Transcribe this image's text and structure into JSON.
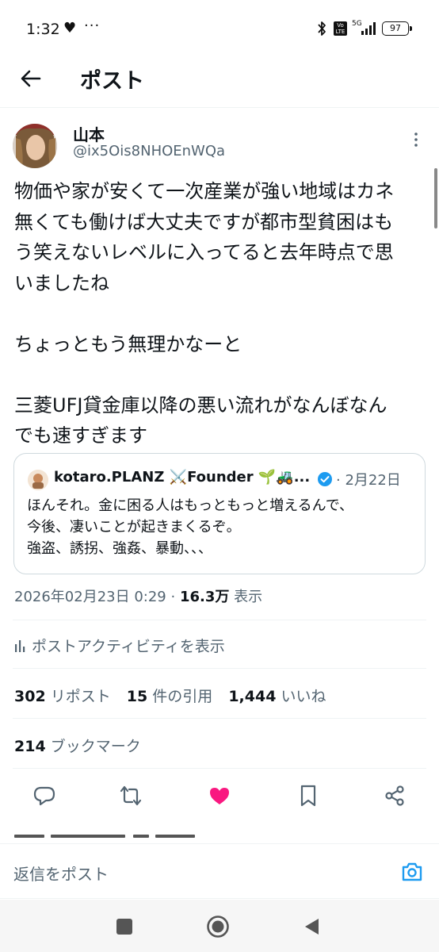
{
  "status_bar": {
    "time": "1:32",
    "battery": "97",
    "network": "5G",
    "volte": "Vo LTE"
  },
  "header": {
    "title": "ポスト"
  },
  "post": {
    "author_name": "山本",
    "author_handle": "@ix5Ois8NHOEnWQa",
    "paragraphs": [
      [
        "物価や家が安くて一次産業が強い地域はカネ",
        "無くても働けば大丈夫ですが都市型貧困はも",
        "う笑えないレベルに入ってると去年時点で思",
        "いましたね"
      ],
      [
        "ちょっともう無理かなーと"
      ],
      [
        "三菱UFJ貸金庫以降の悪い流れがなんぼなん",
        "でも速すぎます"
      ]
    ],
    "quote": {
      "author": "kotaro.PLANZ ⚔️Founder 🌱🚜...",
      "date": "· 2月22日",
      "lines": [
        "ほんそれ。金に困る人はもっともっと増えるんで、",
        "今後、凄いことが起きまくるぞ。",
        "強盗、誘拐、強姦、暴動、、、"
      ]
    },
    "timestamp": "2026年02月23日 0:29",
    "separator": " · ",
    "views_count": "16.3万",
    "views_label": " 表示",
    "activity_label": "ポストアクティビティを表示",
    "reposts_count": "302",
    "reposts_label": " リポスト",
    "quotes_count": "15",
    "quotes_label": " 件の引用",
    "likes_count": "1,444",
    "likes_label": " いいね",
    "bookmarks_count": "214",
    "bookmarks_label": " ブックマーク"
  },
  "reply": {
    "placeholder": "返信をポスト"
  },
  "colors": {
    "text": "#0f1419",
    "muted": "#536471",
    "accent": "#1d9bf0",
    "like": "#f91880",
    "border": "#cfd9de"
  },
  "icons": [
    "back-arrow-icon",
    "more-vert-icon",
    "verified-icon",
    "activity-bars-icon",
    "reply-icon",
    "repost-icon",
    "like-heart-icon",
    "bookmark-icon",
    "share-icon",
    "camera-icon"
  ]
}
